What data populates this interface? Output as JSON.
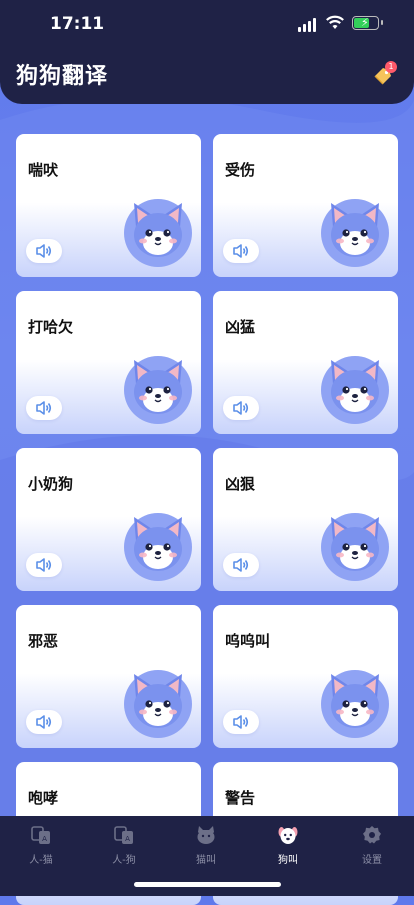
{
  "status": {
    "time": "17:11"
  },
  "header": {
    "title": "狗狗翻译",
    "badge_count": "1"
  },
  "cards": [
    {
      "label": "喘吠"
    },
    {
      "label": "受伤"
    },
    {
      "label": "打哈欠"
    },
    {
      "label": "凶猛"
    },
    {
      "label": "小奶狗"
    },
    {
      "label": "凶狠"
    },
    {
      "label": "邪恶"
    },
    {
      "label": "呜呜叫"
    },
    {
      "label": "咆哮"
    },
    {
      "label": "警告"
    }
  ],
  "tabs": [
    {
      "label": "人-猫",
      "icon": "person-cat-translate-icon",
      "active": false
    },
    {
      "label": "人-狗",
      "icon": "person-dog-translate-icon",
      "active": false
    },
    {
      "label": "猫叫",
      "icon": "cat-face-icon",
      "active": false
    },
    {
      "label": "狗叫",
      "icon": "dog-face-icon",
      "active": true
    },
    {
      "label": "设置",
      "icon": "settings-icon",
      "active": false
    }
  ],
  "colors": {
    "header_bg": "#1f2246",
    "page_bg": "#6b83ee",
    "accent": "#6b7ff0",
    "active_tab_icon": "#f4a0b0"
  }
}
